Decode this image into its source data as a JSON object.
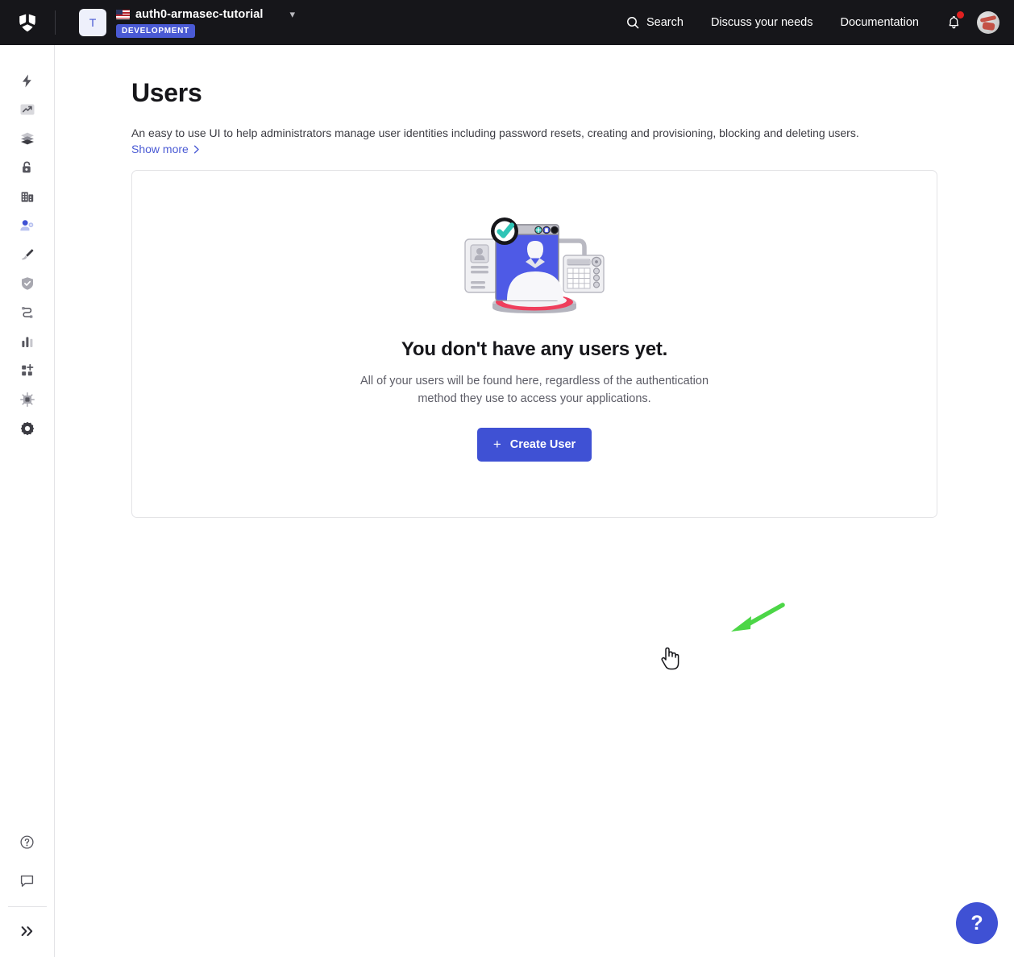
{
  "topbar": {
    "logo_icon": "auth0-logo-icon",
    "tenant": {
      "avatar_letter": "T",
      "name": "auth0-armasec-tutorial",
      "env_badge": "DEVELOPMENT",
      "flag_icon": "us-flag-icon",
      "chevron_icon": "chevron-down-icon"
    },
    "nav": [
      {
        "label": "Search",
        "icon": "search-icon"
      },
      {
        "label": "Discuss your needs",
        "icon": ""
      },
      {
        "label": "Documentation",
        "icon": ""
      }
    ],
    "notifications_icon": "bell-icon",
    "has_notification": true,
    "avatar_icon": "user-avatar"
  },
  "sidebar": {
    "items": [
      {
        "icon": "lightning-bolt-icon",
        "name": "getting-started",
        "active": false
      },
      {
        "icon": "activity-chart-icon",
        "name": "activity",
        "active": false
      },
      {
        "icon": "layers-icon",
        "name": "applications",
        "active": false
      },
      {
        "icon": "unlock-icon",
        "name": "authentication",
        "active": false
      },
      {
        "icon": "building-icon",
        "name": "organizations",
        "active": false
      },
      {
        "icon": "user-management-icon",
        "name": "user-management",
        "active": true
      },
      {
        "icon": "paintbrush-icon",
        "name": "branding",
        "active": false
      },
      {
        "icon": "shield-check-icon",
        "name": "security",
        "active": false
      },
      {
        "icon": "flow-branch-icon",
        "name": "actions",
        "active": false
      },
      {
        "icon": "bar-chart-icon",
        "name": "monitoring",
        "active": false
      },
      {
        "icon": "grid-plus-icon",
        "name": "marketplace",
        "active": false
      },
      {
        "icon": "chip-icon",
        "name": "extensions",
        "active": false
      },
      {
        "icon": "gear-icon",
        "name": "settings",
        "active": false
      }
    ],
    "bottom_items": [
      {
        "icon": "help-circle-icon",
        "name": "help"
      },
      {
        "icon": "chat-bubble-icon",
        "name": "feedback"
      }
    ],
    "expand_icon": "double-chevron-right-icon"
  },
  "main": {
    "title": "Users",
    "description": "An easy to use UI to help administrators manage user identities including password resets, creating and provisioning, blocking and deleting users.",
    "show_more_label": "Show more",
    "show_more_icon": "chevron-right-icon",
    "empty_state": {
      "illustration": "user-profile-screen-illustration",
      "title": "You don't have any users yet.",
      "subtitle": "All of your users will be found here, regardless of the authentication method they use to access your applications.",
      "cta_label": "Create User",
      "cta_icon": "plus-icon"
    },
    "annotation": {
      "arrow_icon": "green-arrow-pointing-to-create-user",
      "cursor_icon": "hand-pointer-cursor"
    }
  },
  "help_fab": {
    "label": "?",
    "icon": "question-mark-icon"
  },
  "colors": {
    "topbar_bg": "#16161a",
    "accent_blue": "#3f51d4",
    "badge_blue": "#4a5ad4",
    "link_blue": "#4a5ad4",
    "card_border": "#e3e3e6",
    "annotation_green": "#4cd647",
    "notification_red": "#e02020"
  }
}
